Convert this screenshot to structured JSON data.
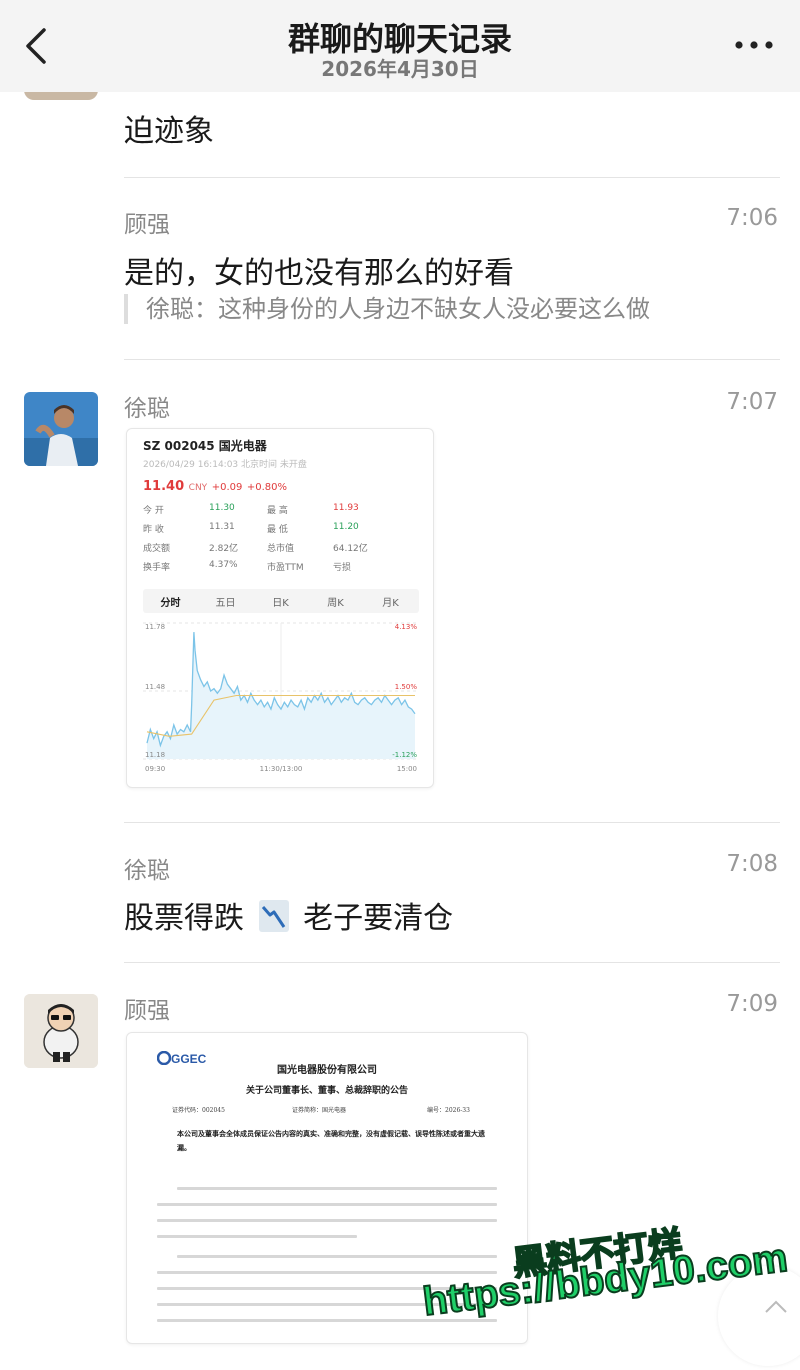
{
  "header": {
    "title": "群聊的聊天记录",
    "date": "2026年4月30日"
  },
  "messages": [
    {
      "text": "迫迹象"
    },
    {
      "sender": "顾强",
      "time": "7:06",
      "text": "是的，女的也没有那么的好看",
      "quote": "徐聪：这种身份的人身边不缺女人没必要这么做"
    },
    {
      "sender": "徐聪",
      "time": "7:07"
    },
    {
      "sender": "徐聪",
      "time": "7:08",
      "text_before": "股票得跌",
      "emoji": "chart-decreasing",
      "text_after": "老子要清仓"
    },
    {
      "sender": "顾强",
      "time": "7:09"
    }
  ],
  "stock_card": {
    "code_name": "SZ 002045 国光电器",
    "timestamp": "2026/04/29 16:14:03 北京时间 未开盘",
    "price": "11.40",
    "currency": "CNY",
    "change": "+0.09",
    "change_pct": "+0.80%",
    "stats": [
      {
        "l1": "今  开",
        "v1": "11.30",
        "l2": "最  高",
        "v2": "11.93"
      },
      {
        "l1": "昨  收",
        "v1": "11.31",
        "l2": "最  低",
        "v2": "11.20"
      },
      {
        "l1": "成交额",
        "v1": "2.82亿",
        "l2": "总市值",
        "v2": "64.12亿"
      },
      {
        "l1": "换手率",
        "v1": "4.37%",
        "l2": "市盈TTM",
        "v2": "亏损"
      }
    ],
    "tabs": [
      "分时",
      "五日",
      "日K",
      "周K",
      "月K"
    ],
    "colors": {
      "up": "#e03b3b",
      "down": "#2aa05a",
      "line": "#7cc4e8",
      "avg": "#e8c36a"
    }
  },
  "chart_data": {
    "type": "line",
    "ylim": [
      11.18,
      11.78
    ],
    "y_ticks_left": [
      "11.78",
      "11.48",
      "11.18"
    ],
    "y_ticks_right": [
      "4.13%",
      "1.50%",
      "-1.12%"
    ],
    "x_ticks": [
      "09:30",
      "11:30/13:00",
      "15:00"
    ],
    "series": [
      {
        "x": [
          0,
          3,
          6,
          9,
          12,
          15,
          18,
          21,
          24,
          27,
          30,
          33,
          36,
          38,
          39,
          40,
          41,
          42,
          43,
          45,
          48,
          51,
          54,
          57,
          60,
          63,
          66,
          69,
          72,
          75,
          78,
          81,
          84,
          87,
          90,
          93,
          96,
          99,
          102,
          105,
          108,
          111,
          114,
          117,
          120,
          123,
          126,
          129,
          132,
          135,
          138,
          141,
          144,
          147,
          150,
          153,
          156,
          159,
          162,
          165,
          168,
          171,
          174,
          177,
          180,
          183,
          186,
          189,
          192,
          195,
          198,
          201,
          204,
          207,
          210,
          213,
          216,
          219,
          222,
          225,
          228,
          231,
          234,
          237,
          240
        ],
        "values": [
          11.25,
          11.31,
          11.27,
          11.3,
          11.24,
          11.28,
          11.3,
          11.27,
          11.33,
          11.29,
          11.31,
          11.3,
          11.33,
          11.31,
          11.3,
          11.42,
          11.58,
          11.74,
          11.66,
          11.57,
          11.53,
          11.5,
          11.52,
          11.48,
          11.49,
          11.47,
          11.49,
          11.55,
          11.51,
          11.49,
          11.47,
          11.5,
          11.44,
          11.46,
          11.43,
          11.47,
          11.44,
          11.42,
          11.44,
          11.41,
          11.43,
          11.4,
          11.45,
          11.42,
          11.4,
          11.43,
          11.41,
          11.44,
          11.42,
          11.41,
          11.44,
          11.4,
          11.45,
          11.43,
          11.46,
          11.44,
          11.47,
          11.43,
          11.45,
          11.42,
          11.44,
          11.46,
          11.43,
          11.45,
          11.44,
          11.47,
          11.43,
          11.42,
          11.44,
          11.45,
          11.43,
          11.42,
          11.44,
          11.45,
          11.43,
          11.46,
          11.44,
          11.42,
          11.44,
          11.45,
          11.42,
          11.44,
          11.41,
          11.4,
          11.38
        ]
      },
      {
        "x": [
          0,
          20,
          40,
          60,
          80,
          100,
          120,
          160,
          200,
          240
        ],
        "values": [
          11.3,
          11.28,
          11.29,
          11.44,
          11.46,
          11.46,
          11.46,
          11.46,
          11.46,
          11.46
        ]
      }
    ]
  },
  "doc_card": {
    "brand": "GGEC",
    "company": "国光电器股份有限公司",
    "title": "关于公司董事长、董事、总裁辞职的公告",
    "meta": [
      "证券代码：002045",
      "证券简称：国光电器",
      "编号：2026-33"
    ],
    "bold_text": "本公司及董事会全体成员保证公告内容的真实、准确和完整，没有虚假记载、误导性陈述或者重大遗漏。"
  },
  "watermark": {
    "line1": "黑料不打烊",
    "line2": "https://bbdy10.com"
  }
}
